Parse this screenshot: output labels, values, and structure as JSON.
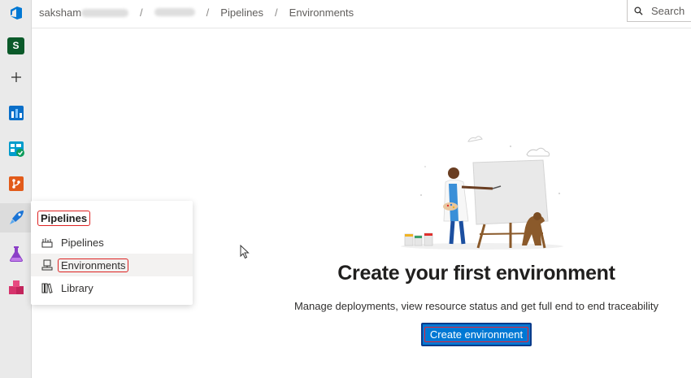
{
  "breadcrumb": {
    "org": "saksham",
    "pipelines": "Pipelines",
    "environments": "Environments",
    "separator": "/"
  },
  "search": {
    "label": "Search",
    "icon": "search-icon"
  },
  "rail": {
    "avatar_letter": "S",
    "items": [
      "project-avatar",
      "add-icon",
      "overview-icon",
      "boards-icon",
      "repos-icon",
      "pipelines-icon",
      "test-plans-icon",
      "artifacts-icon"
    ]
  },
  "flyout": {
    "title": "Pipelines",
    "items": [
      {
        "label": "Pipelines",
        "icon": "pipelines-rocket-icon"
      },
      {
        "label": "Environments",
        "icon": "environments-icon"
      },
      {
        "label": "Library",
        "icon": "library-icon"
      }
    ]
  },
  "main": {
    "heading": "Create your first environment",
    "subtext": "Manage deployments, view resource status and get full end to end traceability",
    "cta_label": "Create environment"
  },
  "colors": {
    "accent": "#0078d4",
    "highlight_box": "#dd2222",
    "rail_bg": "#eaeaea"
  }
}
